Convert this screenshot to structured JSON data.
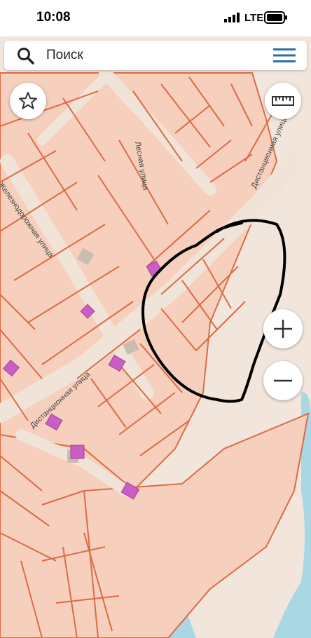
{
  "status_bar": {
    "time": "10:08",
    "network": "LTE"
  },
  "search": {
    "placeholder": "Поиск"
  },
  "map": {
    "streets": [
      "Лесная улица",
      "Дистанционная улица",
      "Железнодорожная улица",
      "Дистанционная улица"
    ],
    "colors": {
      "background": "#f2e6dc",
      "parcel_fill": "#f6d0bd",
      "parcel_border": "#dd6a45",
      "building": "#c95fc4",
      "water": "#a9d8e4",
      "annotation": "#000000"
    }
  },
  "controls": [
    "star-icon",
    "ruler-icon",
    "zoom-in-icon",
    "zoom-out-icon"
  ]
}
